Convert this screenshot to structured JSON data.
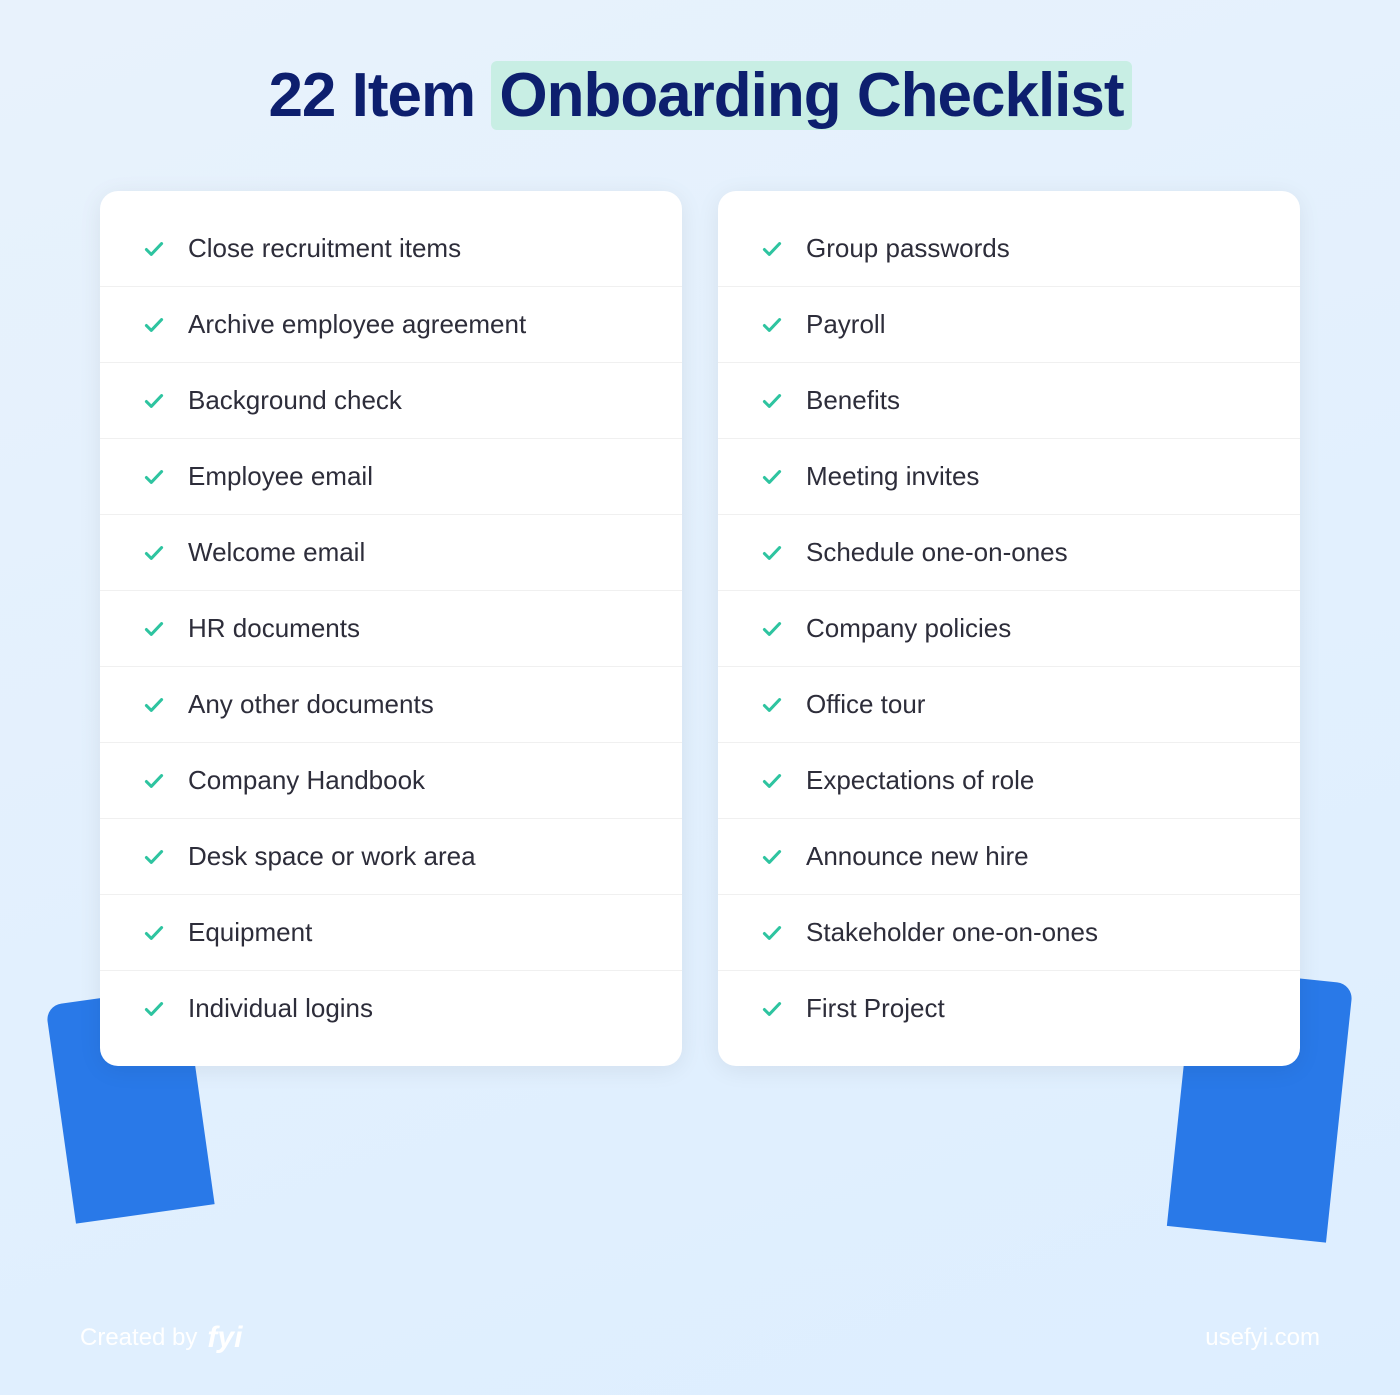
{
  "page": {
    "background": "#e8f0fb",
    "title": {
      "prefix": "22 Item ",
      "highlighted": "Onboarding Checklist"
    }
  },
  "left_column": {
    "items": [
      "Close recruitment items",
      "Archive employee agreement",
      "Background check",
      "Employee email",
      "Welcome email",
      "HR documents",
      "Any other documents",
      "Company Handbook",
      "Desk space or work area",
      "Equipment",
      "Individual logins"
    ]
  },
  "right_column": {
    "items": [
      "Group passwords",
      "Payroll",
      "Benefits",
      "Meeting invites",
      "Schedule one-on-ones",
      "Company policies",
      "Office tour",
      "Expectations of role",
      "Announce new hire",
      "Stakeholder one-on-ones",
      "First Project"
    ]
  },
  "footer": {
    "created_by_label": "Created by",
    "logo": "fyi",
    "website": "usefyi.com"
  }
}
